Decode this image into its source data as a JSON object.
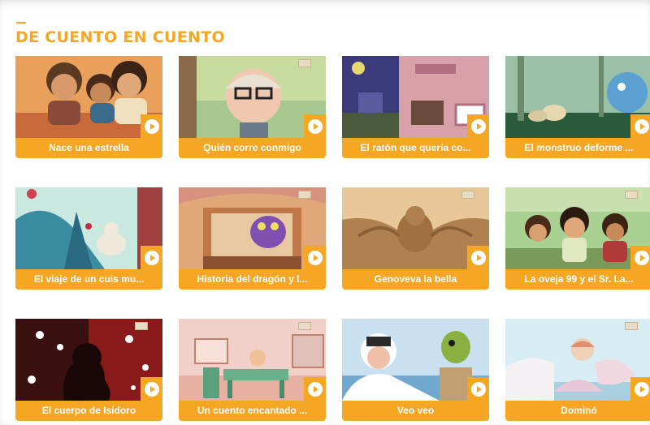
{
  "section": {
    "title": "DE CUENTO EN CUENTO",
    "accent_color": "#f5a623"
  },
  "videos": [
    {
      "title": "Nace una estrella",
      "icon": "play-icon"
    },
    {
      "title": "Quién corre conmigo",
      "icon": "play-icon"
    },
    {
      "title": "El ratón que quería co...",
      "icon": "play-icon"
    },
    {
      "title": "El monstruo deforme ...",
      "icon": "play-icon"
    },
    {
      "title": "El viaje de un cuis mu...",
      "icon": "play-icon"
    },
    {
      "title": "Historia del dragón y l...",
      "icon": "play-icon"
    },
    {
      "title": "Genoveva la bella",
      "icon": "play-icon"
    },
    {
      "title": "La oveja 99 y el Sr. La...",
      "icon": "play-icon"
    },
    {
      "title": "El cuerpo de Isidoro",
      "icon": "play-icon"
    },
    {
      "title": "Un cuento encantado ...",
      "icon": "play-icon"
    },
    {
      "title": "Veo veo",
      "icon": "play-icon"
    },
    {
      "title": "Dominó",
      "icon": "play-icon"
    }
  ]
}
